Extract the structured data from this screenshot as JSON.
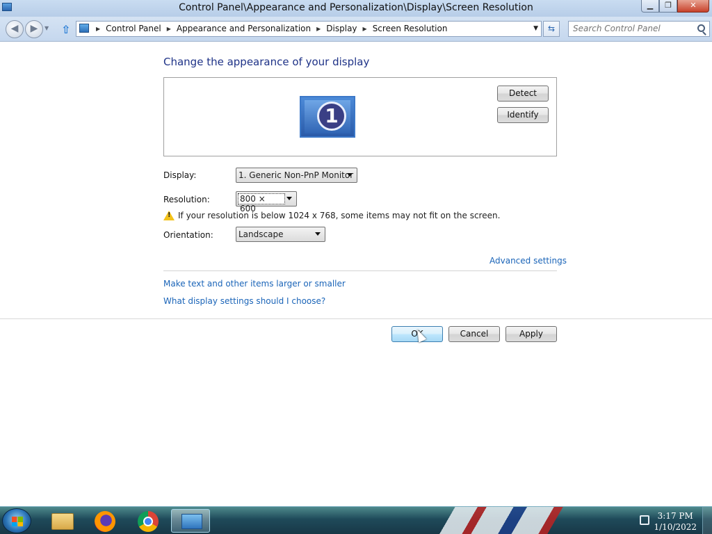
{
  "window": {
    "title": "Control Panel\\Appearance and Personalization\\Display\\Screen Resolution",
    "min_label": "▁",
    "max_label": "❐",
    "close_label": "✕"
  },
  "nav": {
    "breadcrumbs": [
      "Control Panel",
      "Appearance and Personalization",
      "Display",
      "Screen Resolution"
    ],
    "search_placeholder": "Search Control Panel"
  },
  "main": {
    "heading": "Change the appearance of your display",
    "monitor_number": "1",
    "detect_label": "Detect",
    "identify_label": "Identify",
    "display_label": "Display:",
    "display_value": "1. Generic Non-PnP Monitor",
    "resolution_label": "Resolution:",
    "resolution_value": "800 × 600",
    "warning_text": "If your resolution is below 1024 x 768, some items may not fit on the screen.",
    "orientation_label": "Orientation:",
    "orientation_value": "Landscape",
    "advanced_link": "Advanced settings",
    "link_larger": "Make text and other items larger or smaller",
    "link_help": "What display settings should I choose?",
    "ok_label": "OK",
    "cancel_label": "Cancel",
    "apply_label": "Apply"
  },
  "taskbar": {
    "time": "3:17 PM",
    "date": "1/10/2022",
    "icons": [
      "windows-start-icon",
      "file-explorer-icon",
      "firefox-icon",
      "chrome-icon",
      "control-panel-icon",
      "network-icon"
    ]
  },
  "colors": {
    "heading": "#1e3287",
    "link": "#1a64b8",
    "ok_button": "#bee6fd"
  }
}
